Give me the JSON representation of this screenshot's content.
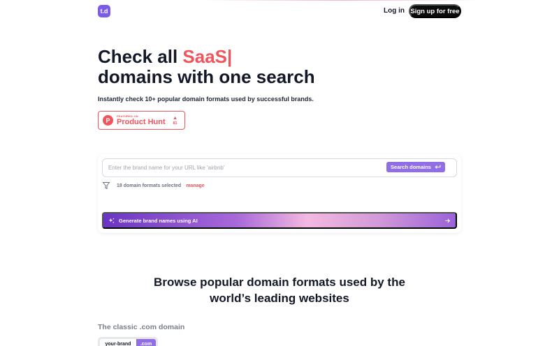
{
  "header": {
    "logo_text": "t.d",
    "login_label": "Log in",
    "signup_label": "Sign up for free"
  },
  "hero": {
    "title_prefix": "Check all ",
    "title_accent": "SaaS",
    "title_caret": "|",
    "title_line2": "domains with one search",
    "subtitle": "Instantly check 10+ popular domain formats used by successful brands."
  },
  "product_hunt": {
    "logo_letter": "P",
    "featured_label": "FEATURED ON",
    "name": "Product Hunt",
    "votes": "81"
  },
  "search": {
    "placeholder": "Enter the brand name for your URL like 'airbnb'",
    "value": "",
    "button_label": "Search domains",
    "formats_text": "18 domain formats selected",
    "manage_label": "manage"
  },
  "ai": {
    "label": "Generate brand names using AI"
  },
  "browse": {
    "title": "Browse popular domain formats used by the world’s leading websites",
    "classic_label": "The classic .com domain",
    "chip_brand": "your-brand",
    "chip_tld": ".com"
  },
  "colors": {
    "accent": "#f2545b",
    "brand_purple": "#8f6ee6",
    "dark": "#0b0b0b"
  },
  "icons": {
    "filter": "filter-icon",
    "enter": "enter-return-icon",
    "sparkle": "sparkle-icon",
    "arrow": "arrow-right-icon",
    "upvote": "triangle-up-icon"
  }
}
